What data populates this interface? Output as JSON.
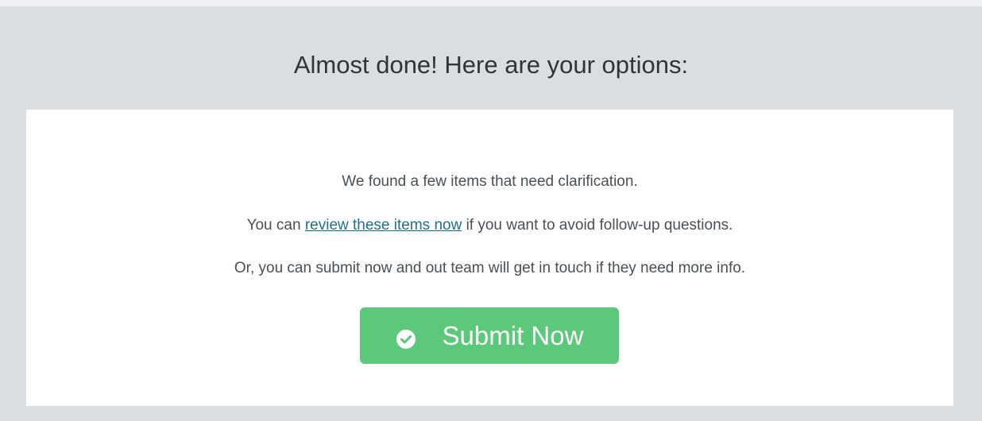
{
  "header": {
    "title": "Almost done! Here are your options:"
  },
  "card": {
    "line1": "We found a few items that need clarification.",
    "line2_prefix": "You can ",
    "line2_link": "review these items now",
    "line2_suffix": " if you want to avoid follow-up questions.",
    "line3": "Or, you can submit now and out team will get in touch if they need more info."
  },
  "submit": {
    "label": "Submit Now",
    "icon": "check-circle-icon",
    "color": "#5cc87a"
  }
}
